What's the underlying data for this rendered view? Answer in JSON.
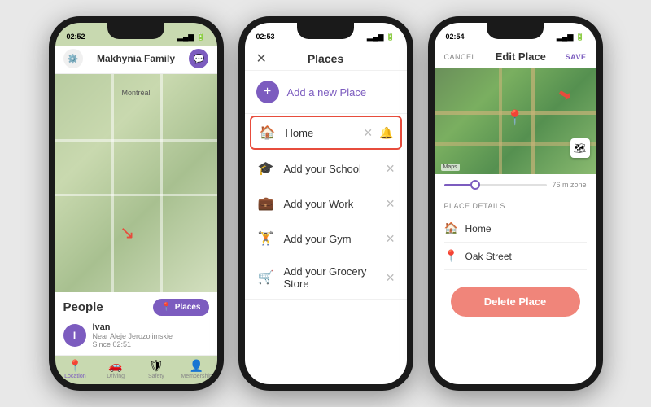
{
  "phone1": {
    "status_time": "02:52",
    "header": {
      "family_name": "Makhynia Family"
    },
    "map": {
      "label": "Montréal"
    },
    "bottom": {
      "people_label": "People",
      "places_btn": "Places",
      "person": {
        "name": "Ivan",
        "location": "Near Aleje Jerozolimskie",
        "since": "Since 02:51",
        "initial": "I"
      }
    },
    "tabs": [
      {
        "label": "Location",
        "icon": "📍",
        "active": true
      },
      {
        "label": "Driving",
        "icon": "🚗"
      },
      {
        "label": "Safety",
        "icon": "🛡"
      },
      {
        "label": "Membership",
        "icon": "👤"
      }
    ]
  },
  "phone2": {
    "status_time": "02:53",
    "header": {
      "title": "Places",
      "close_icon": "✕"
    },
    "add_place": {
      "icon": "+",
      "label": "Add a new Place"
    },
    "places": [
      {
        "id": "home",
        "icon": "🏠",
        "name": "Home",
        "highlighted": true
      },
      {
        "id": "school",
        "icon": "🎓",
        "name": "Add your School",
        "highlighted": false
      },
      {
        "id": "work",
        "icon": "💼",
        "name": "Add your Work",
        "highlighted": false
      },
      {
        "id": "gym",
        "icon": "🏋",
        "name": "Add your Gym",
        "highlighted": false
      },
      {
        "id": "grocery",
        "icon": "🛒",
        "name": "Add your Grocery Store",
        "highlighted": false
      }
    ]
  },
  "phone3": {
    "status_time": "02:54",
    "header": {
      "cancel": "CANCEL",
      "title": "Edit Place",
      "save": "SAVE"
    },
    "map": {
      "source": "Maps"
    },
    "radius_label": "76 m zone",
    "place_details": {
      "title": "Place details",
      "name": "Home",
      "address": "Oak Street"
    },
    "delete_btn": "Delete Place"
  },
  "colors": {
    "purple": "#7c5cbf",
    "red": "#e74c3c",
    "salmon": "#f0857a"
  }
}
